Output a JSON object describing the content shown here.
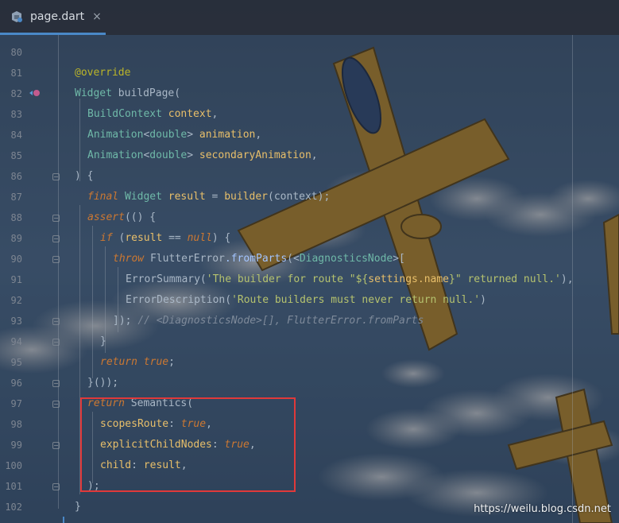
{
  "tab": {
    "filename": "page.dart",
    "close_glyph": "×",
    "icon": "dart-file-icon"
  },
  "colors": {
    "annotation": "#bbb529",
    "keyword": "#cc7832",
    "type": "#6fb9a8",
    "string": "#b5c26e",
    "comment": "#7e8a9a",
    "highlight_box": "#e0393a",
    "tab_underline": "#4a88c7"
  },
  "line_numbers": [
    "80",
    "81",
    "82",
    "83",
    "84",
    "85",
    "86",
    "87",
    "88",
    "89",
    "90",
    "91",
    "92",
    "93",
    "94",
    "95",
    "96",
    "97",
    "98",
    "99",
    "100",
    "101",
    "102"
  ],
  "code": {
    "l81": {
      "annotation": "@override"
    },
    "l82": {
      "return_type": "Widget",
      "method": " buildPage("
    },
    "l83": {
      "type": "BuildContext",
      "name": " context",
      "punc": ","
    },
    "l84": {
      "type": "Animation",
      "generic_open": "<",
      "generic": "double",
      "generic_close": ">",
      "name": " animation",
      "punc": ","
    },
    "l85": {
      "type": "Animation",
      "generic_open": "<",
      "generic": "double",
      "generic_close": ">",
      "name": " secondaryAnimation",
      "punc": ","
    },
    "l86": {
      "text": ") {"
    },
    "l87": {
      "kw": "final",
      "type": " Widget",
      "name": " result",
      "op": " = ",
      "fn": "builder",
      "args": "(context);"
    },
    "l88": {
      "kw": "assert",
      "rest": "(() {"
    },
    "l89": {
      "kw": "if",
      "open": " (",
      "name": "result",
      "op": " == ",
      "null": "null",
      "close": ") {"
    },
    "l90": {
      "kw": "throw",
      "cls": " FlutterError",
      "method": ".fromParts",
      "open": "(<",
      "type": "DiagnosticsNode",
      "close": ">["
    },
    "l91": {
      "cls": "ErrorSummary",
      "open": "(",
      "str1": "'The builder for route \"${",
      "interp": "settings.name",
      "str2": "}\" returned null.'",
      "close": "),"
    },
    "l92": {
      "cls": "ErrorDescription",
      "open": "(",
      "str": "'Route builders must never return null.'",
      "close": ")"
    },
    "l93": {
      "text": "]); ",
      "comment": "// <DiagnosticsNode>[], FlutterError.fromParts"
    },
    "l94": {
      "text": "}"
    },
    "l95": {
      "kw": "return",
      "val": " true",
      "punc": ";"
    },
    "l96": {
      "text": "}());"
    },
    "l97": {
      "kw": "return",
      "cls": " Semantics",
      "punc": "("
    },
    "l98": {
      "name": "scopesRoute",
      "colon": ": ",
      "val": "true",
      "punc": ","
    },
    "l99": {
      "name": "explicitChildNodes",
      "colon": ": ",
      "val": "true",
      "punc": ","
    },
    "l100": {
      "name": "child",
      "colon": ": ",
      "val": "result",
      "punc": ","
    },
    "l101": {
      "text": ");"
    },
    "l102": {
      "text": "}"
    }
  },
  "watermark": "https://weilu.blog.csdn.net"
}
